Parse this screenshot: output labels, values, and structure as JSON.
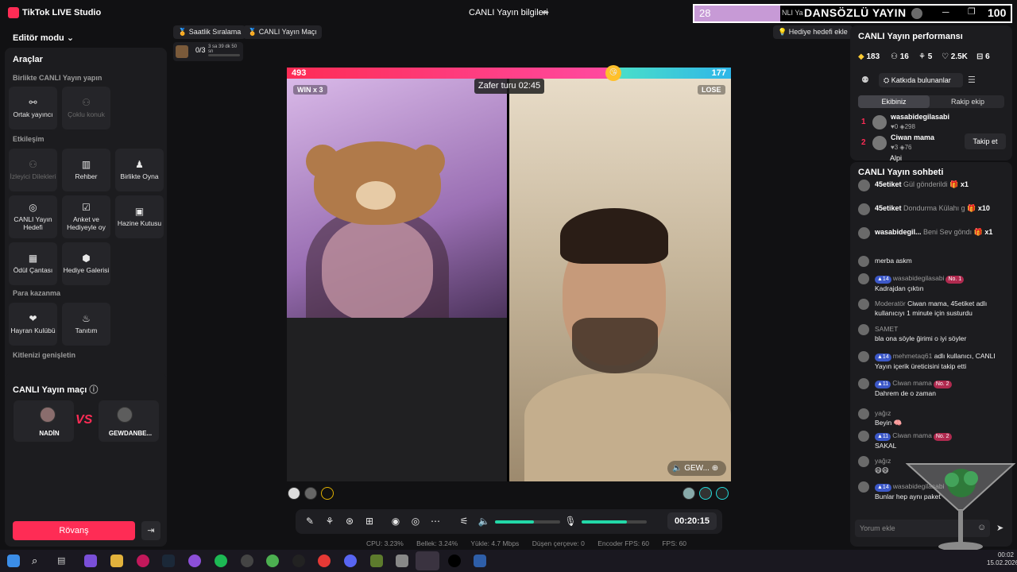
{
  "app": {
    "name": "TikTok LIVE Studio",
    "stream_info_label": "CANLI Yayın bilgileri"
  },
  "overlay": {
    "left_number": "28",
    "title_small": "NLI Ya",
    "title": "DANSÖZLÜ YAYIN",
    "right_number": "100"
  },
  "left_panel": {
    "editor_mode": "Editör modu",
    "tools_title": "Araçlar",
    "section_together": "Birlikte CANLI Yayın yapın",
    "together_tools": [
      {
        "label": "Ortak yayıncı",
        "icon": "link-icon",
        "disabled": false
      },
      {
        "label": "Çoklu konuk",
        "icon": "people-icon",
        "disabled": true
      }
    ],
    "section_interaction": "Etkileşim",
    "interaction_tools": [
      {
        "label": "İzleyici Dilekleri",
        "icon": "people-icon",
        "disabled": true
      },
      {
        "label": "Rehber",
        "icon": "book-icon",
        "disabled": false
      },
      {
        "label": "Birlikte Oyna",
        "icon": "gamepad-icon",
        "disabled": false
      },
      {
        "label": "CANLI Yayın Hedefi",
        "icon": "target-icon",
        "disabled": false
      },
      {
        "label": "Anket ve Hediyeyle oy",
        "icon": "poll-icon",
        "disabled": false
      },
      {
        "label": "Hazine Kutusu",
        "icon": "treasure-icon",
        "disabled": false
      },
      {
        "label": "Ödül Çantası",
        "icon": "bag-icon",
        "disabled": false
      },
      {
        "label": "Hediye Galerisi",
        "icon": "gift-icon",
        "disabled": false
      }
    ],
    "section_monetize": "Para kazanma",
    "monetize_tools": [
      {
        "label": "Hayran Kulübü",
        "icon": "heart-icon",
        "disabled": false
      },
      {
        "label": "Tanıtım",
        "icon": "flame-icon",
        "disabled": false
      }
    ],
    "section_expand": "Kitlenizi genişletin",
    "match_title": "CANLI Yayın maçı",
    "match_left_name": "NADİN",
    "match_vs": "VS",
    "match_right_name": "GEWDANBE...",
    "rematch_label": "Rövanş"
  },
  "center": {
    "chips": {
      "hourly_rank": "Saatlik Sıralama",
      "live_match": "CANLI Yayın Maçı",
      "gift_goal": "Hediye hedefi ekle"
    },
    "goal_progress": "0/3",
    "goal_time": "3 sa 39 dk 50 sn",
    "goal_fraction": 0,
    "score_left": 493,
    "score_right": 177,
    "win_tag": "WIN x 3",
    "lose_tag": "LOSE",
    "round_label": "Zafer turu 02:45",
    "right_name": "GEW...",
    "timer": "00:20:15",
    "volume_fraction": 0.6,
    "mic_fraction": 0.7,
    "stats": {
      "cpu": "CPU: 3.23%",
      "memory": "Bellek: 3.24%",
      "upload": "Yükle: 4.7 Mbps",
      "dropped": "Düşen çerçeve: 0",
      "encoder_fps": "Encoder FPS: 60",
      "fps": "FPS: 60"
    }
  },
  "right_panel": {
    "perf_title": "CANLI Yayın performansı",
    "stats": {
      "diamonds": "183",
      "viewers": "16",
      "shares": "5",
      "likes": "2.5K",
      "gifts": "6"
    },
    "contributors_label": "Katkıda bulunanlar",
    "tab_team": "Ekibiniz",
    "tab_rival": "Rakip ekip",
    "contributors": [
      {
        "rank": "1",
        "name": "wasabidegilasabi",
        "hearts": "0",
        "points": "298"
      },
      {
        "rank": "2",
        "name": "Ciwan mama",
        "hearts": "3",
        "points": "76"
      }
    ],
    "follow_label": "Takip et",
    "contributor_3_partial": "Alpi",
    "chat_title": "CANLI Yayın sohbeti",
    "gift_events": [
      {
        "user": "45etiket",
        "action": "Gül gönderildi",
        "count": "x1"
      },
      {
        "user": "45etiket",
        "action": "Dondurma Külahı g",
        "count": "x10"
      },
      {
        "user": "wasabidegil...",
        "action": "Beni Sev göndı",
        "count": "x1"
      }
    ],
    "messages": [
      {
        "user": "",
        "level": "",
        "rank": "",
        "text": "merba askm"
      },
      {
        "user": "wasabidegilasabi",
        "level": "14",
        "rank": "No. 1",
        "text": "Kadrajdan çıktın"
      },
      {
        "user": "Moderatör",
        "level": "",
        "rank": "",
        "text": "Ciwan mama, 45etiket adlı kullanıcıyı 1 minute için susturdu"
      },
      {
        "user": "SAMET",
        "level": "",
        "rank": "",
        "text": "bla ona söyle ğirimi o iyi söyler"
      },
      {
        "user": "mehmetaq61",
        "level": "14",
        "rank": "",
        "text": "adlı kullanıcı, CANLI Yayın içerik üreticisini takip etti"
      },
      {
        "user": "Ciwan mama",
        "level": "11",
        "rank": "No. 2",
        "text": "Dahrem de o zaman"
      },
      {
        "user": "yağız",
        "level": "",
        "rank": "",
        "text": "Beyin 🧠"
      },
      {
        "user": "Ciwan mama",
        "level": "11",
        "rank": "No. 2",
        "text": "SAKAL"
      },
      {
        "user": "yağız",
        "level": "",
        "rank": "",
        "text": "😄😄"
      },
      {
        "user": "wasabidegilasabi",
        "level": "14",
        "rank": "",
        "text": "Bunlar hep aynı paket"
      }
    ],
    "comment_placeholder": "Yorum ekle"
  },
  "taskbar": {
    "time": "00:02",
    "date": "15.02.2026"
  },
  "colors": {
    "accent": "#fe2c55",
    "teal": "#23d8a8",
    "panel": "#1c1c1f"
  }
}
